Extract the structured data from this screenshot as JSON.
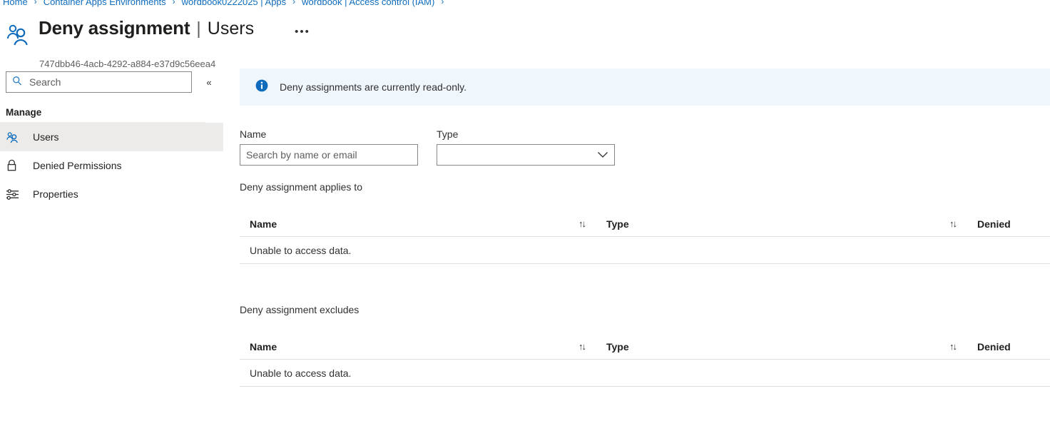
{
  "breadcrumb": {
    "items": [
      {
        "label": "Home"
      },
      {
        "label": "Container Apps Environments"
      },
      {
        "label": "wordbook0222025 | Apps"
      },
      {
        "label": "wordbook | Access control (IAM)"
      }
    ],
    "separator": "›"
  },
  "header": {
    "icon": "users-group-icon",
    "title": "Deny assignment",
    "pipe": "|",
    "subtitle_tab": "Users",
    "overflow_label": "•••",
    "resource_id": "747dbb46-4acb-4292-a884-e37d9c56eea4"
  },
  "sidebar": {
    "search": {
      "placeholder": "Search",
      "value": "",
      "icon": "search-icon"
    },
    "collapse_icon": "«",
    "group_label": "Manage",
    "items": [
      {
        "label": "Users",
        "icon": "users-group-icon",
        "selected": true
      },
      {
        "label": "Denied Permissions",
        "icon": "lock-icon",
        "selected": false
      },
      {
        "label": "Properties",
        "icon": "sliders-icon",
        "selected": false
      }
    ]
  },
  "banner": {
    "icon": "info-icon",
    "text": "Deny assignments are currently read-only.",
    "background": "#eff6fc",
    "accent": "#0f6cbd"
  },
  "filters": {
    "name": {
      "label": "Name",
      "placeholder": "Search by name or email",
      "value": ""
    },
    "type": {
      "label": "Type",
      "value": "",
      "chevron_icon": "chevron-down-icon"
    }
  },
  "sections": [
    {
      "title": "Deny assignment applies to",
      "columns": [
        "Name",
        "Type",
        "Denied"
      ],
      "sort_icon": "↑↓",
      "empty_message": "Unable to access data."
    },
    {
      "title": "Deny assignment excludes",
      "columns": [
        "Name",
        "Type",
        "Denied"
      ],
      "sort_icon": "↑↓",
      "empty_message": "Unable to access data."
    }
  ]
}
